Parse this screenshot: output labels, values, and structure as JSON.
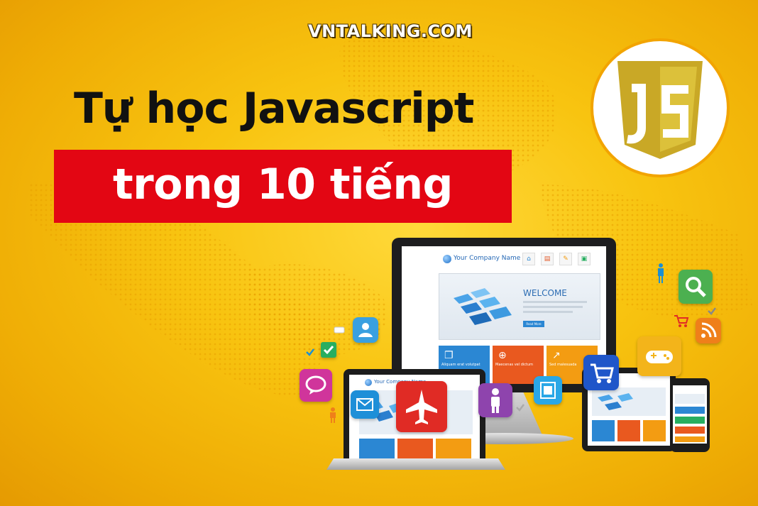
{
  "header": {
    "site_name": "VNTALKING.COM",
    "title": "Tự học Javascript",
    "subtitle": "trong 10 tiếng"
  },
  "logo": {
    "icon": "js-shield-icon",
    "text": "JS"
  },
  "monitor_site": {
    "company": "Your Company Name",
    "nav": [
      "HOME",
      "PROFILE",
      "BLOG",
      "CONTACT"
    ],
    "welcome": "WELCOME",
    "button": "Read More",
    "tiles": [
      "Aliquam erat volutpat",
      "Maecenas vel dictum",
      "Sed malesuada"
    ]
  },
  "laptop_site": {
    "company": "Your Company Name"
  },
  "icons": [
    "plane-icon",
    "user-icon",
    "mail-icon",
    "chat-bubble-icon",
    "search-icon",
    "cart-icon",
    "gamepad-icon",
    "rss-icon",
    "film-icon",
    "person-icon",
    "checkbox-icon"
  ],
  "colors": {
    "background": "#f8c410",
    "banner": "#e30613",
    "js_shield": "#d6b92b",
    "title_text": "#111111"
  }
}
